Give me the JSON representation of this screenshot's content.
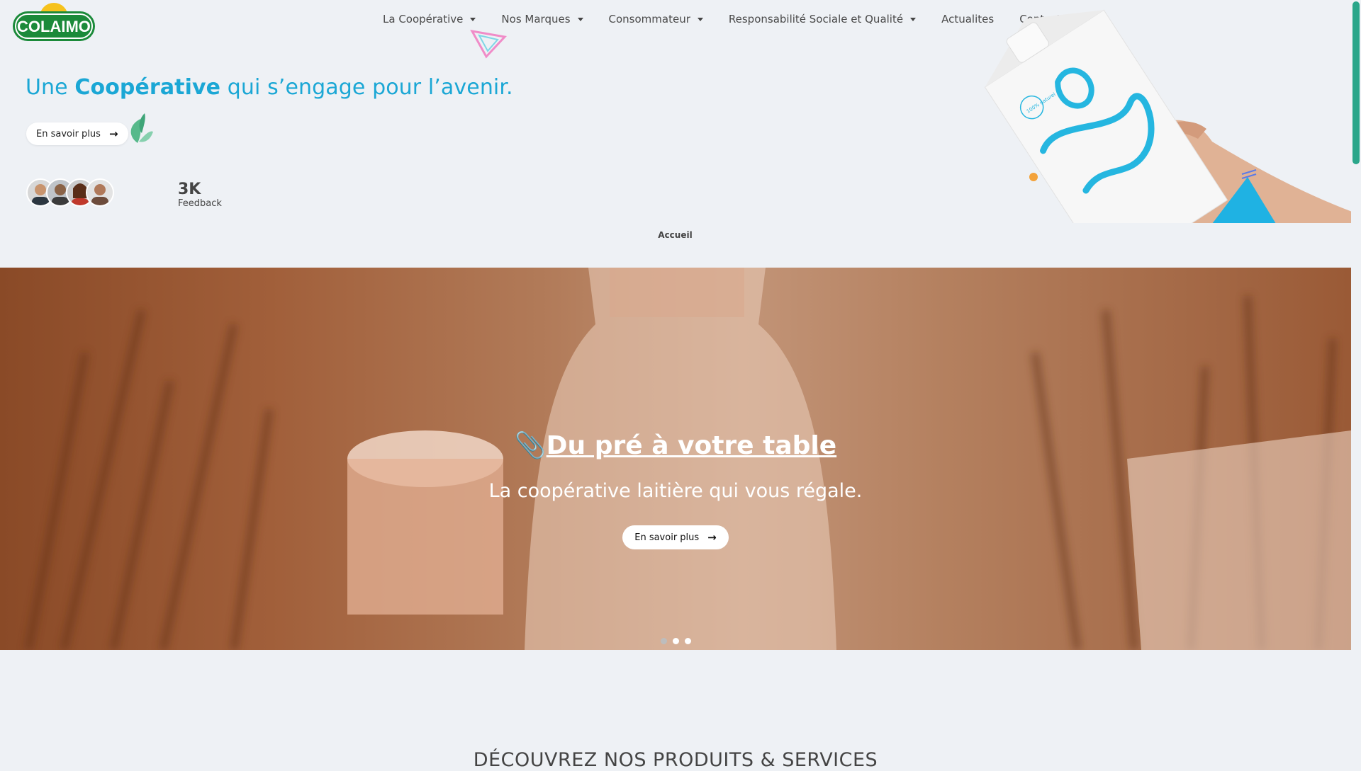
{
  "brand": {
    "logo_text": "COLAIMO",
    "logo_color": "#1b8a3a",
    "accent": "#1ba7d5"
  },
  "nav": {
    "items": [
      {
        "label": "La Coopérative",
        "dropdown": true
      },
      {
        "label": "Nos Marques",
        "dropdown": true
      },
      {
        "label": "Consommateur",
        "dropdown": true
      },
      {
        "label": "Responsabilité Sociale et Qualité",
        "dropdown": true
      },
      {
        "label": "Actualites",
        "dropdown": false
      },
      {
        "label": "Contact",
        "dropdown": true
      }
    ]
  },
  "hero": {
    "title_pre": "Une ",
    "title_bold": "Coopérative",
    "title_post": " qui s’engage pour l’avenir.",
    "button_label": "En savoir plus",
    "stat_value": "3K",
    "stat_label": "Feedback",
    "carton_text": "100% naturel"
  },
  "breadcrumb": "Accueil",
  "slider": {
    "title": "Du pré à votre table",
    "subtitle": "La coopérative laitière qui vous régale.",
    "button_label": "En savoir plus",
    "active_slide": 1,
    "slide_count": 3
  },
  "section": {
    "title": "DÉCOUVREZ NOS PRODUITS & SERVICES"
  }
}
